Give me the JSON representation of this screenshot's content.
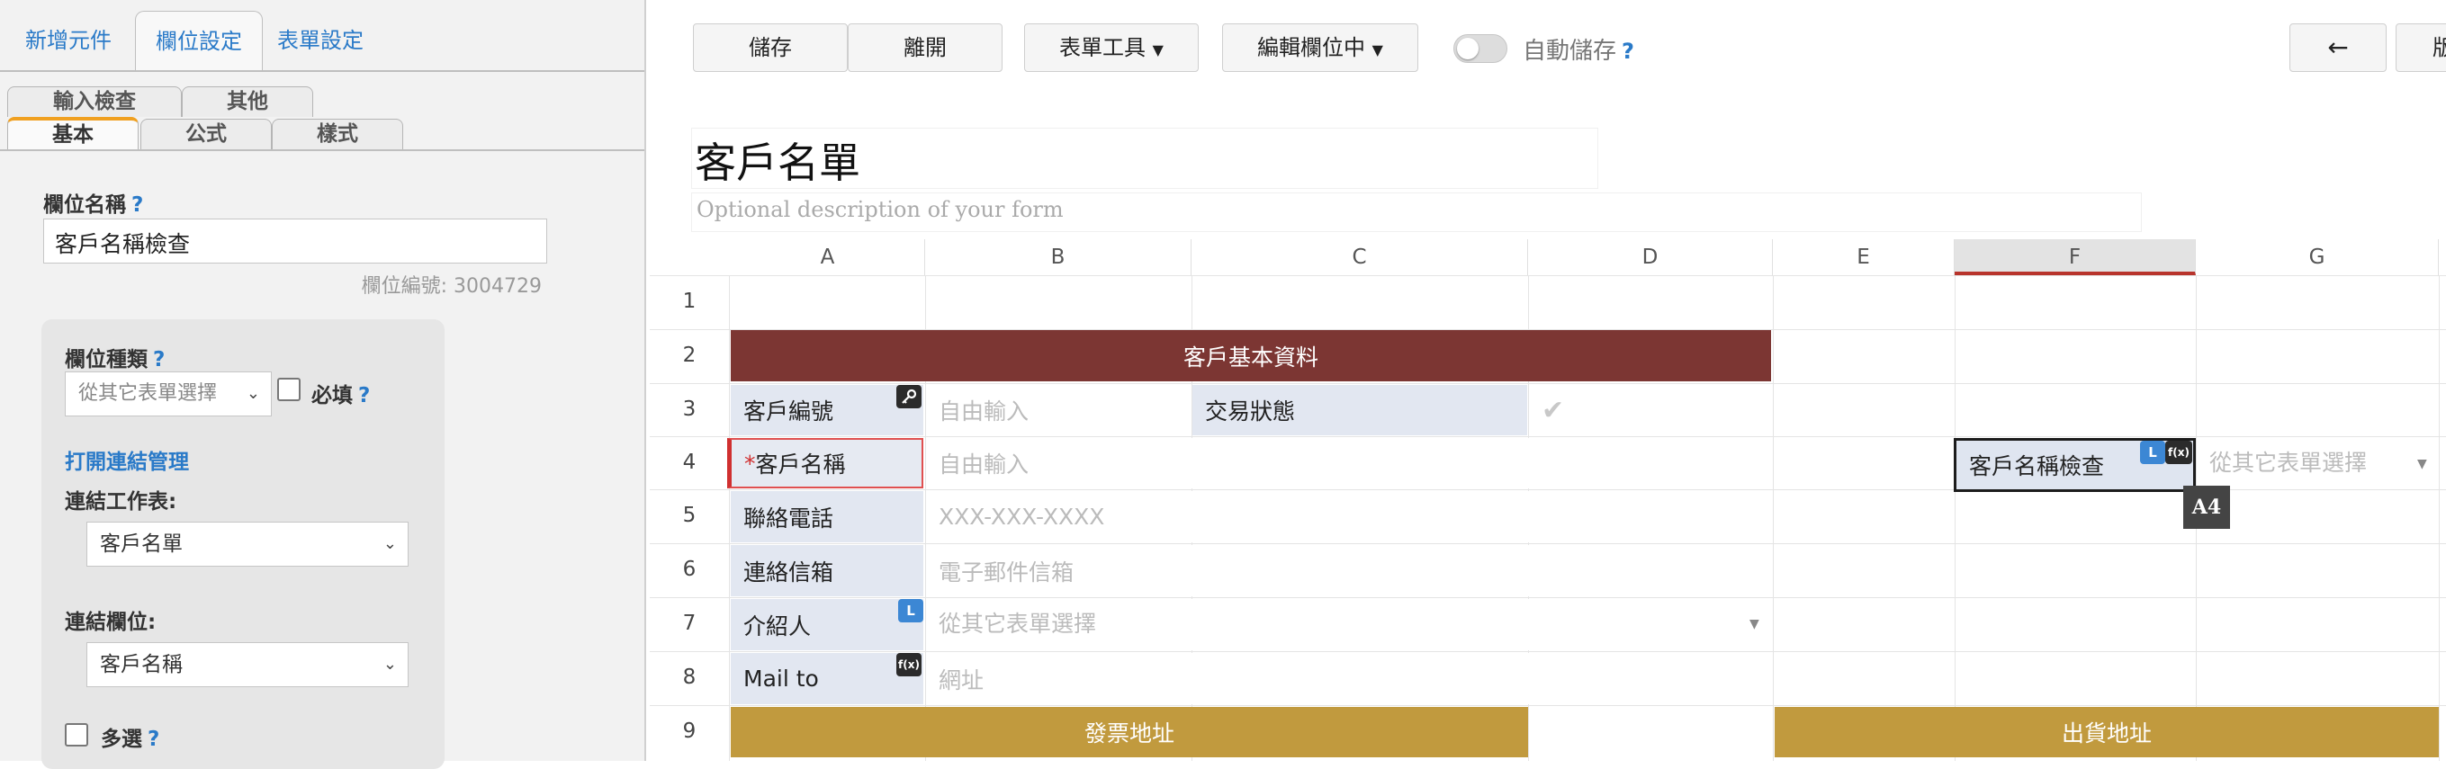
{
  "left_panel": {
    "top_tabs": [
      "新增元件",
      "欄位設定",
      "表單設定"
    ],
    "sub_tabs_back": [
      "輸入檢查",
      "其他"
    ],
    "sub_tabs_front": [
      "基本",
      "公式",
      "樣式"
    ],
    "field_name_label": "欄位名稱",
    "help": "?",
    "field_name_value": "客戶名稱檢查",
    "field_no": "欄位編號: 3004729",
    "field_type_label": "欄位種類",
    "field_type_value": "從其它表單選擇",
    "required_label": "必填",
    "open_link_mgmt": "打開連結管理",
    "link_sheet_label": "連結工作表:",
    "link_sheet_value": "客戶名單",
    "link_field_label": "連結欄位:",
    "link_field_value": "客戶名稱",
    "multi_label": "多選"
  },
  "toolbar": {
    "save": "儲存",
    "leave": "離開",
    "form_tools": "表單工具",
    "editing": "編輯欄位中",
    "autosave": "自動儲存",
    "help": "?",
    "back_arrow": "←",
    "cut_label": "版"
  },
  "form": {
    "title": "客戶名單",
    "description": "Optional description of your form"
  },
  "grid": {
    "columns": [
      "A",
      "B",
      "C",
      "D",
      "E",
      "F",
      "G"
    ],
    "rows": [
      "1",
      "2",
      "3",
      "4",
      "5",
      "6",
      "7",
      "8",
      "9"
    ],
    "section_customer": "客戶基本資料",
    "cust_no_label": "客戶編號",
    "cust_no_placeholder": "自由輸入",
    "trade_status_label": "交易狀態",
    "cust_name_required": "*",
    "cust_name_label": "客戶名稱",
    "cust_name_placeholder": "自由輸入",
    "phone_label": "聯絡電話",
    "phone_placeholder": "XXX-XXX-XXXX",
    "email_label": "連絡信箱",
    "email_placeholder": "電子郵件信箱",
    "referrer_label": "介紹人",
    "referrer_placeholder": "從其它表單選擇",
    "mail_label": "Mail to",
    "mail_placeholder": "網址",
    "invoice_addr": "發票地址",
    "ship_addr": "出貨地址",
    "selected_field_label": "客戶名稱檢查",
    "selected_field_placeholder": "從其它表單選擇",
    "cell_tooltip": "A4",
    "badge_l": "L",
    "badge_fx": "f(x)",
    "check_mark": "✔"
  },
  "colors": {
    "accent_blue": "#2a7ac8",
    "section_red": "#7c3633",
    "section_gold": "#c19a3e",
    "label_bg": "#e2e7f1",
    "active_tab_orange": "#f0a020"
  }
}
